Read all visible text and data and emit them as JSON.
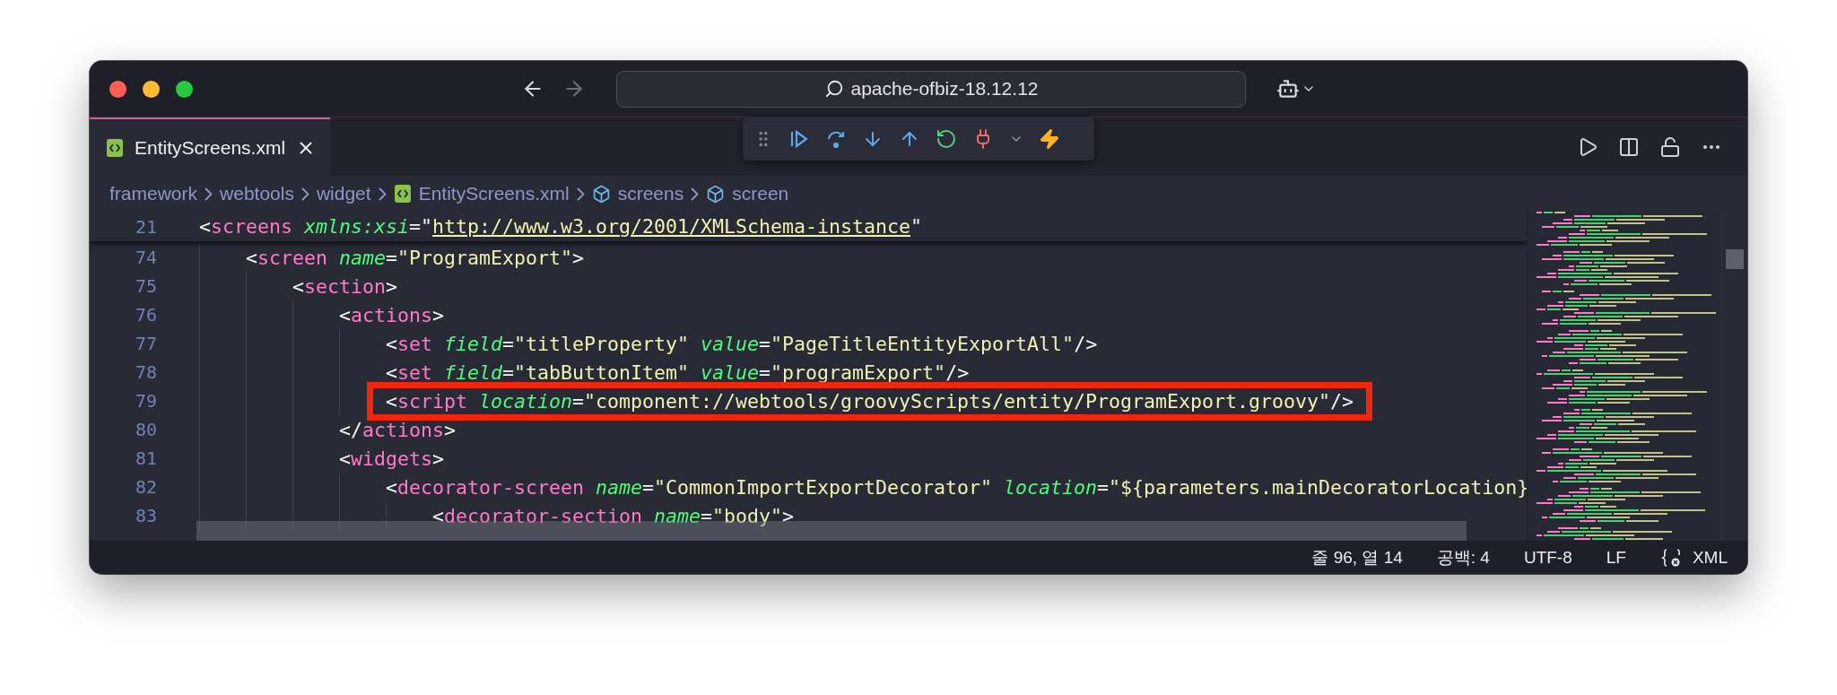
{
  "window": {
    "title": "apache-ofbiz-18.12.12"
  },
  "tabs": [
    {
      "label": "EntityScreens.xml",
      "selected": true
    }
  ],
  "breadcrumbs": [
    {
      "label": "framework",
      "kind": "folder"
    },
    {
      "label": "webtools",
      "kind": "folder"
    },
    {
      "label": "widget",
      "kind": "folder"
    },
    {
      "label": "EntityScreens.xml",
      "kind": "file"
    },
    {
      "label": "screens",
      "kind": "symbol"
    },
    {
      "label": "screen",
      "kind": "symbol"
    }
  ],
  "sticky_line": {
    "number": "21",
    "tokens": [
      {
        "kind": "punct",
        "text": "<"
      },
      {
        "kind": "tag",
        "text": "screens"
      },
      {
        "kind": "attr",
        "text": " xmlns:xsi"
      },
      {
        "kind": "punct",
        "text": "=\""
      },
      {
        "kind": "link",
        "text": "http://www.w3.org/2001/XMLSchema-instance"
      },
      {
        "kind": "punct",
        "text": "\""
      }
    ]
  },
  "code_lines": [
    {
      "number": "74",
      "highlighted": false,
      "tokens": [
        {
          "kind": "punct",
          "text": "<"
        },
        {
          "kind": "tag",
          "text": "screen"
        },
        {
          "kind": "attr",
          "text": " name"
        },
        {
          "kind": "punct",
          "text": "="
        },
        {
          "kind": "value",
          "text": "\"ProgramExport\""
        },
        {
          "kind": "punct",
          "text": ">"
        }
      ],
      "children": [
        {
          "number": "75",
          "highlighted": false,
          "tokens": [
            {
              "kind": "punct",
              "text": "<"
            },
            {
              "kind": "tag",
              "text": "section"
            },
            {
              "kind": "punct",
              "text": ">"
            }
          ],
          "children": [
            {
              "number": "76",
              "highlighted": false,
              "tokens": [
                {
                  "kind": "punct",
                  "text": "<"
                },
                {
                  "kind": "tag",
                  "text": "actions"
                },
                {
                  "kind": "punct",
                  "text": ">"
                }
              ],
              "children": [
                {
                  "number": "77",
                  "highlighted": false,
                  "tokens": [
                    {
                      "kind": "punct",
                      "text": "<"
                    },
                    {
                      "kind": "tag",
                      "text": "set"
                    },
                    {
                      "kind": "attr",
                      "text": " field"
                    },
                    {
                      "kind": "punct",
                      "text": "="
                    },
                    {
                      "kind": "value",
                      "text": "\"titleProperty\""
                    },
                    {
                      "kind": "attr",
                      "text": " value"
                    },
                    {
                      "kind": "punct",
                      "text": "="
                    },
                    {
                      "kind": "value",
                      "text": "\"PageTitleEntityExportAll\""
                    },
                    {
                      "kind": "punct",
                      "text": "/>"
                    }
                  ]
                },
                {
                  "number": "78",
                  "highlighted": false,
                  "tokens": [
                    {
                      "kind": "punct",
                      "text": "<"
                    },
                    {
                      "kind": "tag",
                      "text": "set"
                    },
                    {
                      "kind": "attr",
                      "text": " field"
                    },
                    {
                      "kind": "punct",
                      "text": "="
                    },
                    {
                      "kind": "value",
                      "text": "\"tabButtonItem\""
                    },
                    {
                      "kind": "attr",
                      "text": " value"
                    },
                    {
                      "kind": "punct",
                      "text": "="
                    },
                    {
                      "kind": "value",
                      "text": "\"programExport\""
                    },
                    {
                      "kind": "punct",
                      "text": "/>"
                    }
                  ]
                },
                {
                  "number": "79",
                  "highlighted": true,
                  "tokens": [
                    {
                      "kind": "punct",
                      "text": "<"
                    },
                    {
                      "kind": "tag",
                      "text": "script"
                    },
                    {
                      "kind": "attr",
                      "text": " location"
                    },
                    {
                      "kind": "punct",
                      "text": "="
                    },
                    {
                      "kind": "value",
                      "text": "\"component://webtools/groovyScripts/entity/ProgramExport.groovy\""
                    },
                    {
                      "kind": "punct",
                      "text": "/>"
                    }
                  ]
                }
              ]
            },
            {
              "number": "80",
              "highlighted": false,
              "tokens": [
                {
                  "kind": "punct",
                  "text": "</"
                },
                {
                  "kind": "tag",
                  "text": "actions"
                },
                {
                  "kind": "punct",
                  "text": ">"
                }
              ]
            },
            {
              "number": "81",
              "highlighted": false,
              "tokens": [
                {
                  "kind": "punct",
                  "text": "<"
                },
                {
                  "kind": "tag",
                  "text": "widgets"
                },
                {
                  "kind": "punct",
                  "text": ">"
                }
              ],
              "children": [
                {
                  "number": "82",
                  "highlighted": false,
                  "tokens": [
                    {
                      "kind": "punct",
                      "text": "<"
                    },
                    {
                      "kind": "tag",
                      "text": "decorator-screen"
                    },
                    {
                      "kind": "attr",
                      "text": " name"
                    },
                    {
                      "kind": "punct",
                      "text": "="
                    },
                    {
                      "kind": "value",
                      "text": "\"CommonImportExportDecorator\""
                    },
                    {
                      "kind": "attr",
                      "text": " location"
                    },
                    {
                      "kind": "punct",
                      "text": "="
                    },
                    {
                      "kind": "value",
                      "text": "\"${parameters.mainDecoratorLocation}"
                    }
                  ],
                  "children": [
                    {
                      "number": "83",
                      "highlighted": false,
                      "tokens": [
                        {
                          "kind": "punct",
                          "text": "<"
                        },
                        {
                          "kind": "tag",
                          "text": "decorator-section"
                        },
                        {
                          "kind": "attr",
                          "text": " name"
                        },
                        {
                          "kind": "punct",
                          "text": "="
                        },
                        {
                          "kind": "value",
                          "text": "\"body\""
                        },
                        {
                          "kind": "punct",
                          "text": ">"
                        }
                      ]
                    }
                  ]
                }
              ]
            }
          ]
        }
      ]
    }
  ],
  "status_bar": [
    {
      "text": "줄 96, 열 14",
      "kind": "plain"
    },
    {
      "text": "공백: 4",
      "kind": "plain"
    },
    {
      "text": "UTF-8",
      "kind": "plain"
    },
    {
      "text": "LF",
      "kind": "plain"
    },
    {
      "text": "XML",
      "kind": "language"
    }
  ]
}
